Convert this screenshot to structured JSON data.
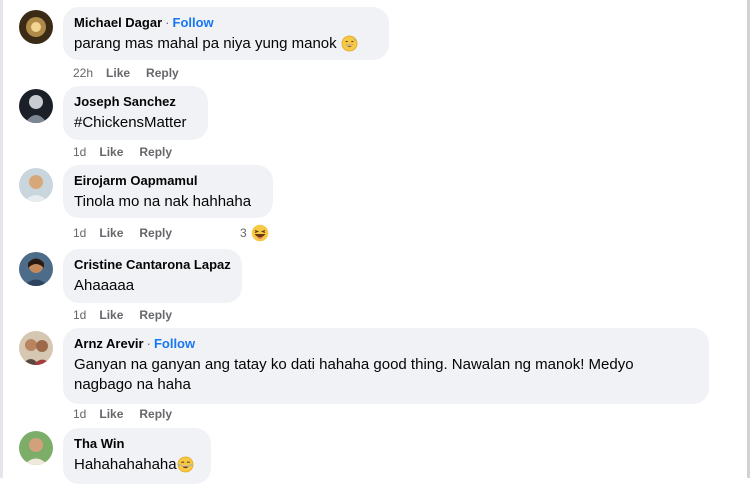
{
  "comments": [
    {
      "author": "Michael Dagar",
      "follow": "Follow",
      "dot": "·",
      "text": "parang mas mahal pa niya yung manok",
      "emoji": "grinning-sweat-emoji",
      "time": "22h",
      "like": "Like",
      "reply": "Reply"
    },
    {
      "author": "Joseph Sanchez",
      "text": "#ChickensMatter",
      "time": "1d",
      "like": "Like",
      "reply": "Reply"
    },
    {
      "author": "Eirojarm Oapmamul",
      "text": "Tinola mo na nak hahhaha",
      "time": "1d",
      "like": "Like",
      "reply": "Reply",
      "reaction_count": "3",
      "reaction_emoji": "laughing-emoji"
    },
    {
      "author": "Cristine Cantarona Lapaz",
      "text": "Ahaaaaa",
      "time": "1d",
      "like": "Like",
      "reply": "Reply"
    },
    {
      "author": "Arnz Arevir",
      "follow": "Follow",
      "dot": "·",
      "text_line1": "Ganyan na ganyan ang tatay ko dati hahaha good thing. Nawalan ng manok! Medyo",
      "text_line2": "nagbago na haha",
      "time": "1d",
      "like": "Like",
      "reply": "Reply"
    },
    {
      "author": "Tha Win",
      "text": "Hahahahahaha",
      "emoji": "laughing-tears-emoji"
    }
  ],
  "colors": {
    "bubble": "#f0f2f5",
    "follow": "#1877f2",
    "meta": "#65676b",
    "text": "#050505"
  }
}
